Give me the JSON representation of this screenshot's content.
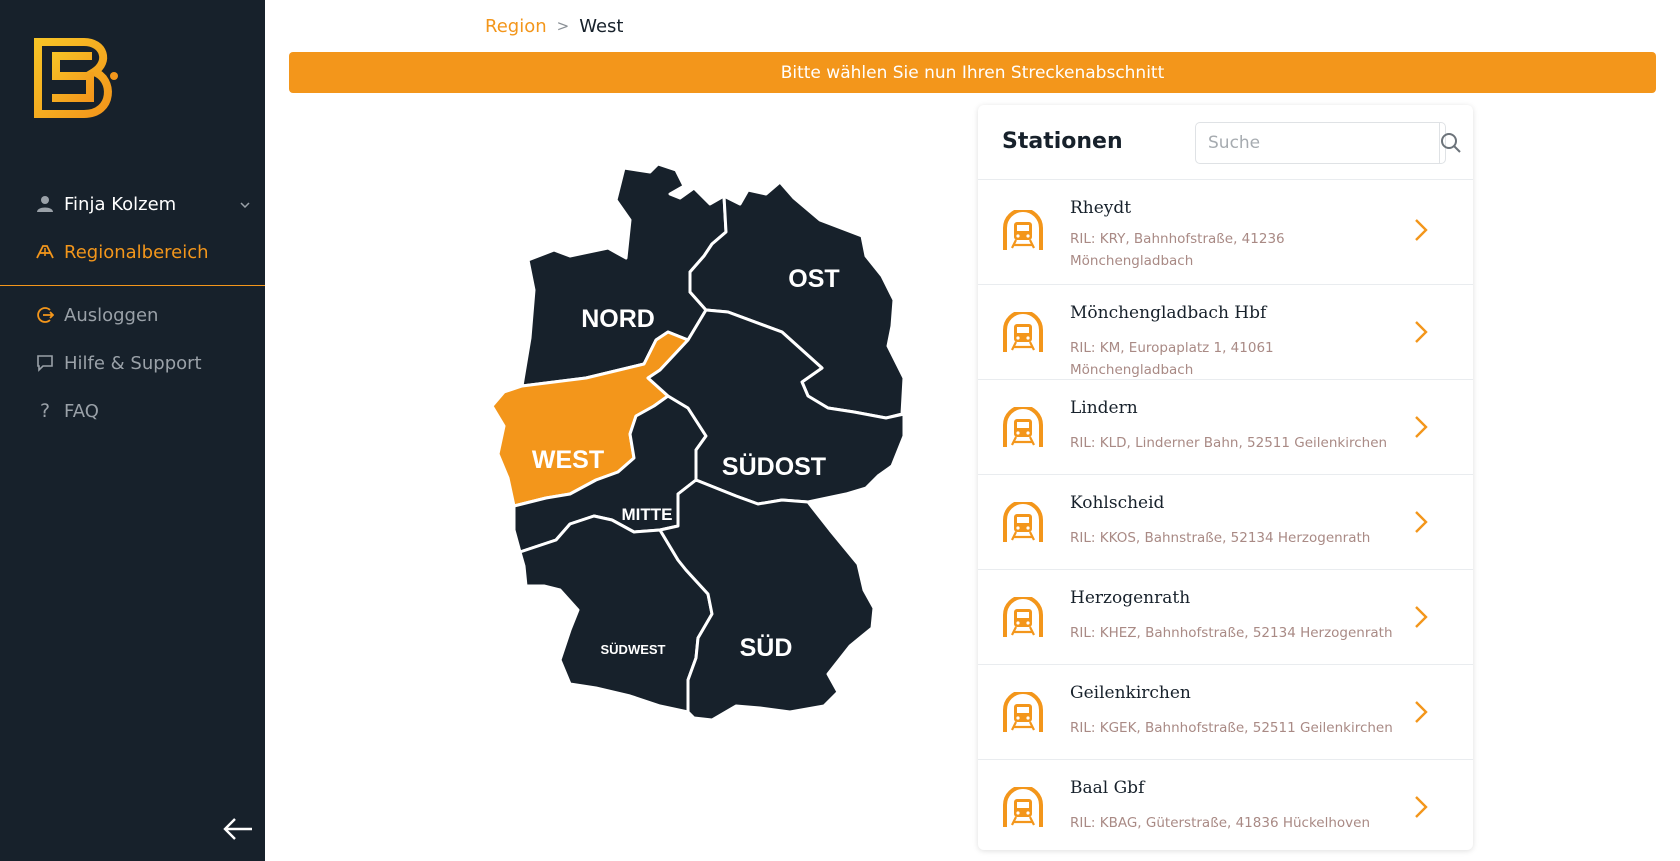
{
  "sidebar": {
    "user_name": "Finja Kolzem",
    "nav": {
      "regional": "Regionalbereich",
      "logout": "Ausloggen",
      "help": "Hilfe & Support",
      "faq": "FAQ"
    }
  },
  "breadcrumb": {
    "region": "Region",
    "separator": ">",
    "current": "West"
  },
  "banner": "Bitte wählen Sie nun Ihren Streckenabschnitt",
  "map": {
    "regions": [
      "NORD",
      "OST",
      "WEST",
      "MITTE",
      "SÜDOST",
      "SÜDWEST",
      "SÜD"
    ],
    "selected": "WEST",
    "colors": {
      "region": "#17212b",
      "selected": "#f3961b",
      "border": "#ffffff"
    }
  },
  "panel": {
    "title": "Stationen",
    "search_placeholder": "Suche",
    "stations": [
      {
        "name": "Rheydt",
        "address": "RIL: KRY, Bahnhofstraße, 41236 Mönchengladbach"
      },
      {
        "name": "Mönchengladbach Hbf",
        "address": "RIL: KM, Europaplatz 1, 41061 Mönchengladbach"
      },
      {
        "name": "Lindern",
        "address": "RIL: KLD, Linderner Bahn, 52511 Geilenkirchen"
      },
      {
        "name": "Kohlscheid",
        "address": "RIL: KKOS, Bahnstraße, 52134 Herzogenrath"
      },
      {
        "name": "Herzogenrath",
        "address": "RIL: KHEZ, Bahnhofstraße, 52134 Herzogenrath"
      },
      {
        "name": "Geilenkirchen",
        "address": "RIL: KGEK, Bahnhofstraße, 52511 Geilenkirchen"
      },
      {
        "name": "Baal Gbf",
        "address": "RIL: KBAG, Güterstraße, 41836 Hückelhoven"
      }
    ]
  },
  "colors": {
    "accent": "#f3961b",
    "sidebar": "#17212b",
    "muted_text": "#a98a85"
  },
  "icons": [
    "logo-icon",
    "user-icon",
    "chevron-down-icon",
    "route-icon",
    "logout-icon",
    "chat-icon",
    "question-icon",
    "arrow-left-icon",
    "search-icon",
    "train-icon",
    "chevron-right-icon"
  ]
}
